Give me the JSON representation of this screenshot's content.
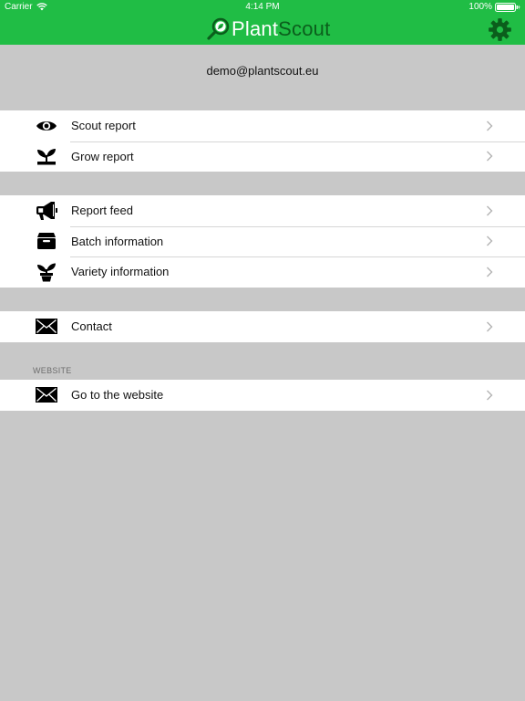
{
  "status_bar": {
    "carrier": "Carrier",
    "time": "4:14 PM",
    "battery": "100%"
  },
  "nav": {
    "logo_part1": "Plant",
    "logo_part2": "Scout",
    "settings_icon": "gear-icon"
  },
  "account": {
    "email": "demo@plantscout.eu"
  },
  "groups": [
    {
      "items": [
        {
          "label": "Scout report",
          "icon": "eye-icon"
        },
        {
          "label": "Grow report",
          "icon": "sprout-icon"
        }
      ]
    },
    {
      "items": [
        {
          "label": "Report feed",
          "icon": "megaphone-icon"
        },
        {
          "label": "Batch information",
          "icon": "box-icon"
        },
        {
          "label": "Variety information",
          "icon": "potted-plant-icon"
        }
      ]
    },
    {
      "items": [
        {
          "label": "Contact",
          "icon": "envelope-icon"
        }
      ]
    },
    {
      "header": "WEBSITE",
      "items": [
        {
          "label": "Go to the website",
          "icon": "envelope-icon"
        }
      ]
    }
  ],
  "colors": {
    "brand_green": "#20bd45",
    "logo_dark_green": "#0b5e1c",
    "background": "#c8c8c8"
  }
}
